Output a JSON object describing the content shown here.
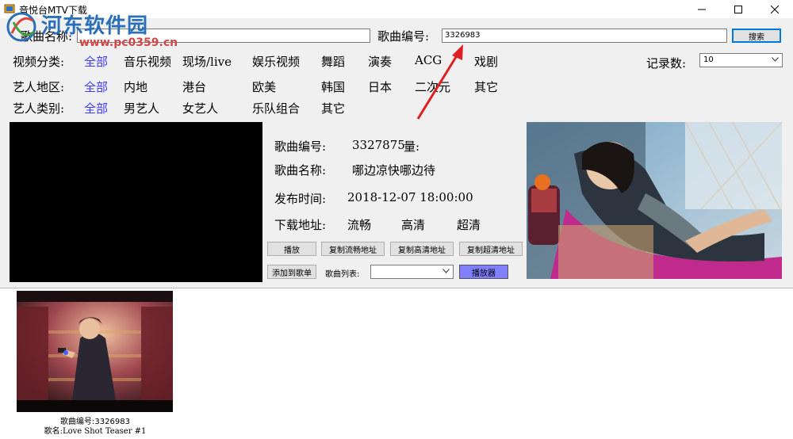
{
  "window": {
    "title": "音悦台MTV下载"
  },
  "watermark": {
    "site_name": "河东软件园",
    "url": "www.pc0359.cn"
  },
  "search": {
    "song_name_label": "歌曲名称:",
    "song_name_value": "",
    "song_id_label": "歌曲编号:",
    "song_id_value": "3326983",
    "search_button": "搜索"
  },
  "filters": {
    "video_category": {
      "label": "视频分类:",
      "options": [
        "全部",
        "音乐视频",
        "现场/live",
        "娱乐视频",
        "舞蹈",
        "演奏",
        "ACG",
        "戏剧"
      ]
    },
    "artist_region": {
      "label": "艺人地区:",
      "options": [
        "全部",
        "内地",
        "港台",
        "欧美",
        "韩国",
        "日本",
        "二次元",
        "其它"
      ]
    },
    "artist_type": {
      "label": "艺人类别:",
      "options": [
        "全部",
        "男艺人",
        "女艺人",
        "乐队组合",
        "其它"
      ]
    },
    "record_count": {
      "label": "记录数:",
      "value": "10"
    }
  },
  "details": {
    "song_id_label": "歌曲编号:",
    "song_id_value": "3327875",
    "song_id_overlap": "量:",
    "song_name_label": "歌曲名称:",
    "song_name_value": "哪边凉快哪边待",
    "release_label": "发布时间:",
    "release_value": "2018-12-07 18:00:00",
    "download_label": "下载地址:",
    "quality_options": [
      "流畅",
      "高清",
      "超清"
    ]
  },
  "actions": {
    "play": "播放",
    "copy_smooth": "复制流畅地址",
    "copy_hd": "复制高清地址",
    "copy_uhd": "复制超清地址",
    "add_to_playlist": "添加到歌单",
    "playlist_label": "歌曲列表:",
    "playlist_value": "",
    "player": "播放器"
  },
  "results": [
    {
      "id_line": "歌曲编号:3326983",
      "name_line": "歌名:Love Shot Teaser #1"
    }
  ],
  "colors": {
    "link": "#3b3bff",
    "window_bg": "#f0f0f0",
    "player_button": "#8080ff",
    "arrow": "#e02020"
  }
}
